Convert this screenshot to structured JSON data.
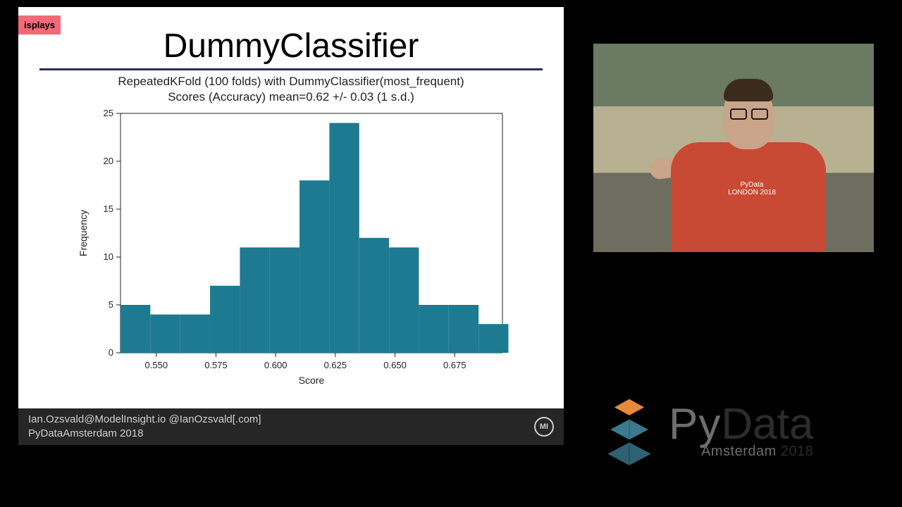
{
  "slide": {
    "tag": "isplays",
    "title": "DummyClassifier",
    "footer_line1": "Ian.Ozsvald@ModelInsight.io @IanOzsvald[.com]",
    "footer_line2": "PyDataAmsterdam 2018",
    "footer_badge": "MI"
  },
  "branding": {
    "py": "Py",
    "data": "Data",
    "sub_city": "Amsterdam ",
    "sub_year": "2018"
  },
  "chart_data": {
    "type": "bar",
    "title_line1": "RepeatedKFold (100 folds) with DummyClassifier(most_frequent)",
    "title_line2": "Scores (Accuracy) mean=0.62 +/- 0.03 (1 s.d.)",
    "xlabel": "Score",
    "ylabel": "Frequency",
    "x_ticks": [
      0.55,
      0.575,
      0.6,
      0.625,
      0.65,
      0.675
    ],
    "y_ticks": [
      0,
      5,
      10,
      15,
      20,
      25
    ],
    "xlim": [
      0.535,
      0.695
    ],
    "ylim": [
      0,
      25
    ],
    "bin_width": 0.0125,
    "bins_start": 0.535,
    "values": [
      5,
      4,
      4,
      7,
      11,
      11,
      18,
      24,
      12,
      11,
      5,
      5,
      3
    ],
    "bar_color": "#1e7a91"
  }
}
